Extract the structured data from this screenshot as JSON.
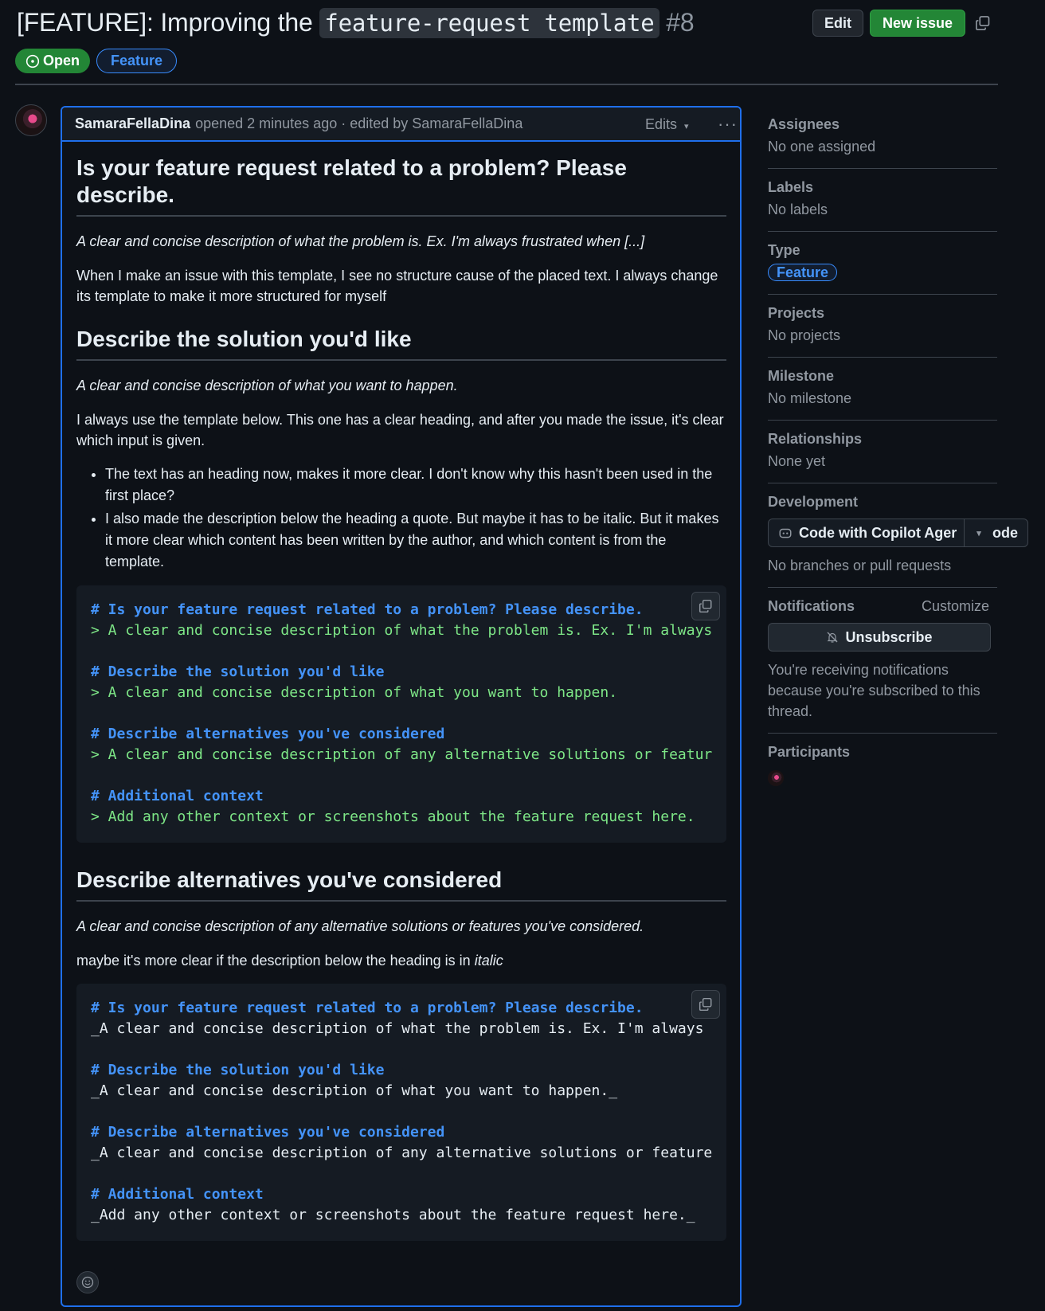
{
  "header": {
    "title_prefix": "[FEATURE]: Improving the",
    "title_code": "feature-request template",
    "number": "#8",
    "edit_label": "Edit",
    "new_issue_label": "New issue",
    "state_label": "Open",
    "type_label": "Feature"
  },
  "comment": {
    "author": "SamaraFellaDina",
    "meta": "opened 2 minutes ago · edited by SamaraFellaDina",
    "edits_label": "Edits",
    "h1": "Is your feature request related to a problem? Please describe.",
    "h1_desc": "A clear and concise description of what the problem is. Ex. I'm always frustrated when [...]",
    "p1": "When I make an issue with this template, I see no structure cause of the placed text. I always change its template to make it more structured for myself",
    "h2": "Describe the solution you'd like",
    "h2_desc": "A clear and concise description of what you want to happen.",
    "p2": "I always use the template below. This one has a clear heading, and after you made the issue, it's clear which input is given.",
    "bullets": [
      "The text has an heading now, makes it more clear. I don't know why this hasn't been used in the first place?",
      "I also made the description below the heading a quote. But maybe it has to be italic. But it makes it more clear which content has been written by the author, and which content is from the template."
    ],
    "code1": [
      "# Is your feature request related to a problem? Please describe.",
      "> A clear and concise description of what the problem is. Ex. I'm always",
      "# Describe the solution you'd like",
      "> A clear and concise description of what you want to happen.",
      "# Describe alternatives you've considered",
      "> A clear and concise description of any alternative solutions or featur",
      "# Additional context",
      "> Add any other context or screenshots about the feature request here."
    ],
    "h3": "Describe alternatives you've considered",
    "h3_desc": "A clear and concise description of any alternative solutions or features you've considered.",
    "p3_text": "maybe it's more clear if the description below the heading is in",
    "p3_em": "italic",
    "code2": [
      "# Is your feature request related to a problem? Please describe.",
      "_A clear and concise description of what the problem is. Ex. I'm always",
      "# Describe the solution you'd like",
      "_A clear and concise description of what you want to happen._",
      "# Describe alternatives you've considered",
      "_A clear and concise description of any alternative solutions or feature",
      "# Additional context",
      "_Add any other context or screenshots about the feature request here._"
    ]
  },
  "sidebar": {
    "assignees_title": "Assignees",
    "assignees_value": "No one assigned",
    "labels_title": "Labels",
    "labels_value": "No labels",
    "type_title": "Type",
    "type_value": "Feature",
    "projects_title": "Projects",
    "projects_value": "No projects",
    "milestone_title": "Milestone",
    "milestone_value": "No milestone",
    "relationships_title": "Relationships",
    "relationships_value": "None yet",
    "development_title": "Development",
    "dev_button_label": "Code with Copilot Ager",
    "dev_button_tail": "ode",
    "development_value": "No branches or pull requests",
    "notifications_title": "Notifications",
    "customize_label": "Customize",
    "unsubscribe_label": "Unsubscribe",
    "notifications_note": "You're receiving notifications because you're subscribed to this thread.",
    "participants_title": "Participants"
  },
  "colors": {
    "background": "#0d1117",
    "accent_blue": "#4493f8",
    "open_green": "#238636",
    "quote_green": "#7ee787"
  }
}
